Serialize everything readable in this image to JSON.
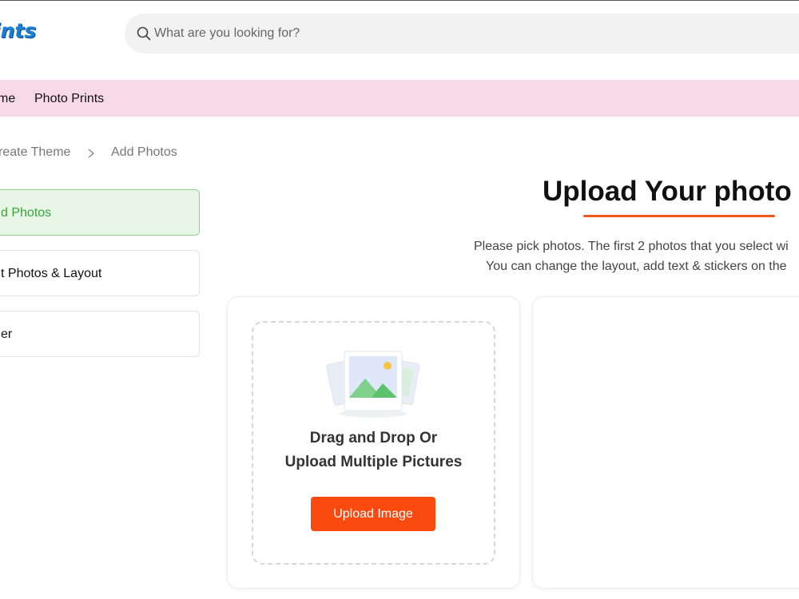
{
  "header": {
    "logo_text": "ints",
    "search_placeholder": "What are you looking for?"
  },
  "nav": {
    "items": [
      "me",
      "Photo Prints"
    ]
  },
  "breadcrumb": {
    "items": [
      "reate Theme",
      "Add Photos"
    ],
    "separator": ">"
  },
  "steps": [
    {
      "label": "d Photos",
      "active": true
    },
    {
      "label": "t Photos & Layout",
      "active": false
    },
    {
      "label": "er",
      "active": false
    }
  ],
  "main": {
    "title": "Upload Your photo",
    "desc_line1": "Please pick photos. The first 2 photos that you select wi",
    "desc_line2": "You can change the layout, add text & stickers on the",
    "dropzone": {
      "line1": "Drag and Drop Or",
      "line2": "Upload Multiple Pictures",
      "button_label": "Upload Image"
    }
  },
  "colors": {
    "accent": "#fb4a0f",
    "nav_bg": "#f7d9e8",
    "active_step_bg": "#e8f6e8",
    "active_step_text": "#3aa53a",
    "logo": "#1a7fd4"
  }
}
